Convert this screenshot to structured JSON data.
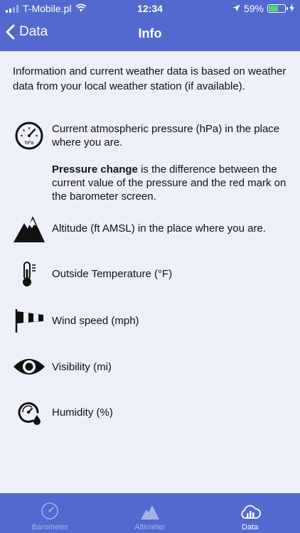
{
  "status_bar": {
    "carrier": "T-Mobile.pl",
    "time": "12:34",
    "battery_percent": "59%",
    "battery_level": 0.59
  },
  "nav": {
    "back_label": "Data",
    "title": "Info"
  },
  "intro": "Information and current weather data is based on weather data from your local weather station (if available).",
  "items": [
    {
      "label": "Current atmospheric pressure (hPa) in the place where you are.",
      "icon": "barometer-icon",
      "icon_text": "hPa"
    },
    {
      "label": "Altitude (ft AMSL) in the place where you are.",
      "icon": "mountain-icon"
    },
    {
      "label": "Outside Temperature (°F)",
      "icon": "thermometer-icon"
    },
    {
      "label": "Wind speed (mph)",
      "icon": "windsock-icon"
    },
    {
      "label": "Visibility (mi)",
      "icon": "eye-icon"
    },
    {
      "label": "Humidity (%)",
      "icon": "humidity-gauge-icon"
    }
  ],
  "pressure_note": {
    "bold": "Pressure change",
    "rest": " is the difference between the current value of the pressure and the red mark on the barometer screen."
  },
  "tabs": [
    {
      "label": "Barometer",
      "icon": "gauge-icon",
      "active": false
    },
    {
      "label": "Altimeter",
      "icon": "mountain-icon",
      "active": false
    },
    {
      "label": "Data",
      "icon": "cloud-chart-icon",
      "active": true
    }
  ],
  "colors": {
    "header": "#5369cf",
    "background": "#eef0f9",
    "tab_inactive": "#a6b1e5",
    "battery": "#4cd964"
  }
}
